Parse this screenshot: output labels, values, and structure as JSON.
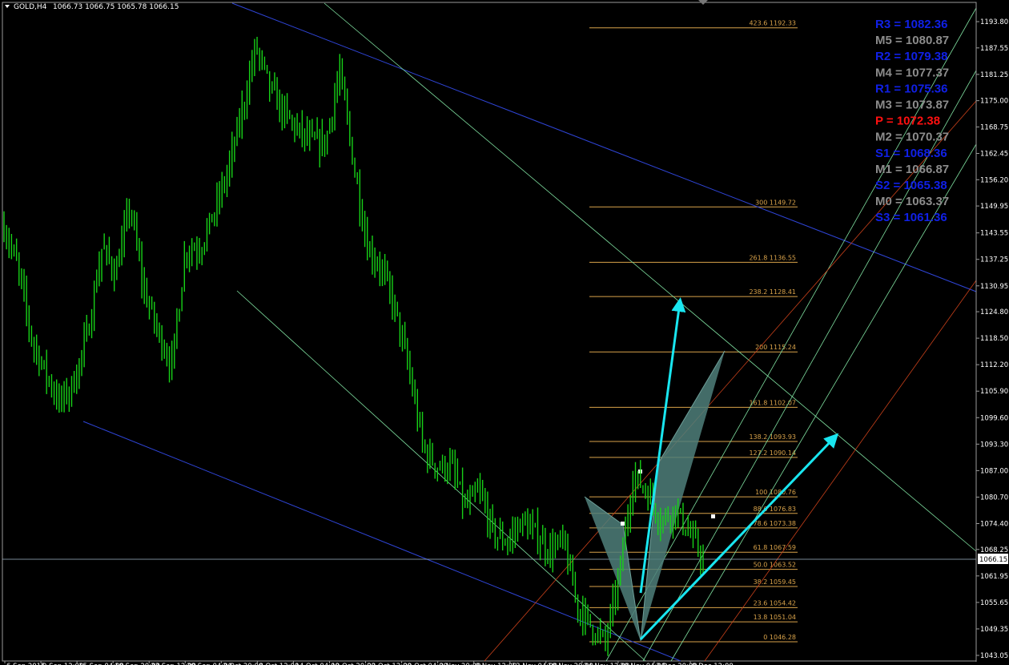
{
  "header": {
    "symbol": "GOLD,H4",
    "ohlc": "1066.73 1066.75 1065.78 1066.15"
  },
  "current_price": "1066.15",
  "colors": {
    "candle": "#17d117",
    "fib": "#d8a24a",
    "arrow": "#19e6f0",
    "channel_blue": "#2f45d8",
    "channel_green": "#7fe0a0",
    "channel_red": "#c8401a",
    "pattern": "#4f7f7a",
    "pivot_blue": "#1020e6",
    "pivot_gray": "#8c8c8c",
    "pivot_red": "#ff1010"
  },
  "price_axis": [
    "1193.80",
    "1187.55",
    "1181.25",
    "1175.00",
    "1168.75",
    "1162.45",
    "1156.20",
    "1149.95",
    "1143.55",
    "1137.25",
    "1130.95",
    "1124.80",
    "1118.50",
    "1112.20",
    "1105.90",
    "1099.60",
    "1093.30",
    "1087.00",
    "1080.70",
    "1074.40",
    "1068.25",
    "1061.95",
    "1055.65",
    "1049.35",
    "1043.05"
  ],
  "fib_levels": [
    "423.6 1192.33",
    "300 1149.72",
    "261.8 1136.55",
    "238.2 1128.41",
    "200 1115.24",
    "161.8 1102.07",
    "138.2 1093.93",
    "127.2 1090.14",
    "100 1080.76",
    "88.6 1076.83",
    "78.6 1073.38",
    "61.8 1067.59",
    "50.0 1063.52",
    "38.2 1059.45",
    "23.6 1054.42",
    "13.8 1051.04",
    "0 1046.28"
  ],
  "pivots": [
    {
      "label": "R3 = 1082.36",
      "kind": "blue"
    },
    {
      "label": "M5 = 1080.87",
      "kind": "gray"
    },
    {
      "label": "R2 = 1079.38",
      "kind": "blue"
    },
    {
      "label": "M4 = 1077.37",
      "kind": "gray"
    },
    {
      "label": "R1 = 1075.36",
      "kind": "blue"
    },
    {
      "label": "M3 = 1073.87",
      "kind": "gray"
    },
    {
      "label": "P  = 1072.38",
      "kind": "red"
    },
    {
      "label": "M2 = 1070.37",
      "kind": "gray"
    },
    {
      "label": "S1 = 1068.36",
      "kind": "blue"
    },
    {
      "label": "M1 = 1066.87",
      "kind": "gray"
    },
    {
      "label": "S2 = 1065.38",
      "kind": "blue"
    },
    {
      "label": "M0 = 1063.37",
      "kind": "gray"
    },
    {
      "label": "S3 = 1061.36",
      "kind": "blue"
    }
  ],
  "time_axis": [
    "6 Sep 2015",
    "9 Sep 12:00",
    "15 Sep 04:00",
    "18 Sep 20:00",
    "23 Sep 12:00",
    "29 Sep 04:00",
    "2 Oct 20:00",
    "8 Oct 12:00",
    "14 Oct 04:00",
    "19 Oct 20:00",
    "23 Oct 12:00",
    "29 Oct 04:00",
    "3 Nov 20:00",
    "9 Nov 12:00",
    "13 Nov 04:00",
    "18 Nov 20:00",
    "24 Nov 12:00",
    "30 Nov 04:00",
    "3 Dec 20:00",
    "9 Dec 12:00"
  ],
  "chart_data": {
    "type": "candlestick",
    "title": "GOLD,H4",
    "ylim": [
      1043.05,
      1193.8
    ],
    "close_path": [
      [
        "6 Sep",
        1145
      ],
      [
        "8 Sep",
        1135
      ],
      [
        "10 Sep",
        1118
      ],
      [
        "12 Sep",
        1110
      ],
      [
        "14 Sep",
        1103
      ],
      [
        "16 Sep",
        1108
      ],
      [
        "18 Sep",
        1120
      ],
      [
        "20 Sep",
        1140
      ],
      [
        "22 Sep",
        1134
      ],
      [
        "24 Sep",
        1150
      ],
      [
        "26 Sep",
        1130
      ],
      [
        "28 Sep",
        1120
      ],
      [
        "30 Sep",
        1112
      ],
      [
        "2 Oct",
        1140
      ],
      [
        "4 Oct",
        1140
      ],
      [
        "6 Oct",
        1148
      ],
      [
        "8 Oct",
        1158
      ],
      [
        "10 Oct",
        1172
      ],
      [
        "12 Oct",
        1188
      ],
      [
        "14 Oct",
        1178
      ],
      [
        "16 Oct",
        1172
      ],
      [
        "18 Oct",
        1168
      ],
      [
        "20 Oct",
        1165
      ],
      [
        "22 Oct",
        1165
      ],
      [
        "24 Oct",
        1182
      ],
      [
        "26 Oct",
        1160
      ],
      [
        "28 Oct",
        1140
      ],
      [
        "30 Oct",
        1135
      ],
      [
        "1 Nov",
        1125
      ],
      [
        "3 Nov",
        1110
      ],
      [
        "5 Nov",
        1092
      ],
      [
        "7 Nov",
        1088
      ],
      [
        "9 Nov",
        1088
      ],
      [
        "11 Nov",
        1078
      ],
      [
        "13 Nov",
        1082
      ],
      [
        "15 Nov",
        1072
      ],
      [
        "17 Nov",
        1070
      ],
      [
        "19 Nov",
        1075
      ],
      [
        "21 Nov",
        1072
      ],
      [
        "23 Nov",
        1068
      ],
      [
        "25 Nov",
        1070
      ],
      [
        "27 Nov",
        1055
      ],
      [
        "29 Nov",
        1050
      ],
      [
        "1 Dec",
        1046
      ],
      [
        "2 Dec",
        1062
      ],
      [
        "3 Dec",
        1086
      ],
      [
        "4 Dec",
        1082
      ],
      [
        "5 Dec",
        1075
      ],
      [
        "6 Dec",
        1078
      ],
      [
        "7 Dec",
        1072
      ],
      [
        "8 Dec",
        1066
      ]
    ]
  }
}
